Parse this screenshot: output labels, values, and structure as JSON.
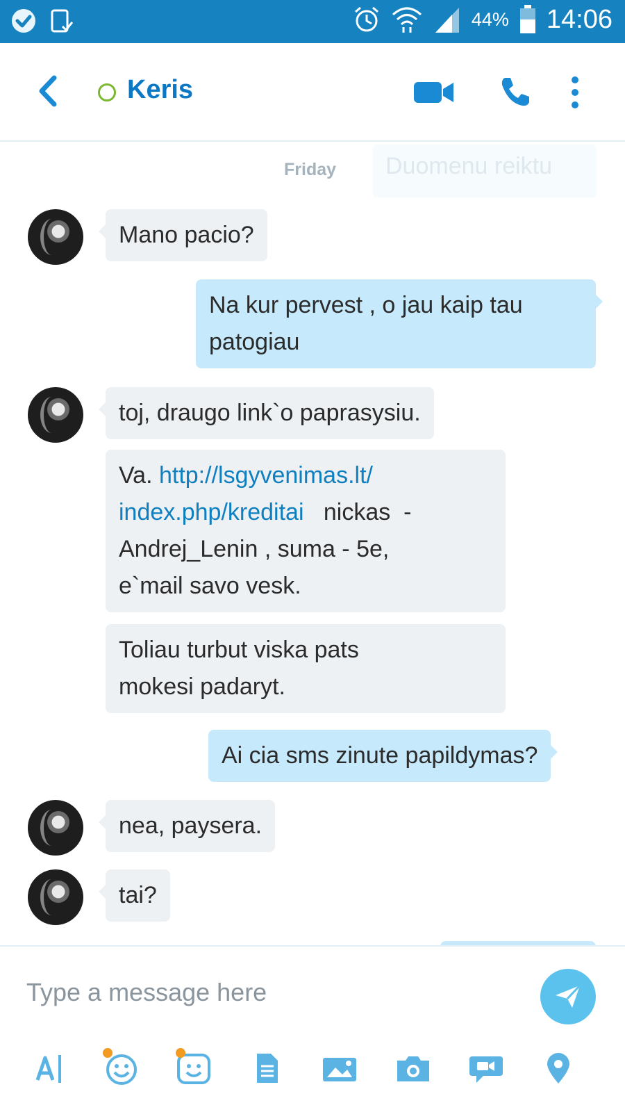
{
  "status_bar": {
    "battery": "44%",
    "time": "14:06",
    "icons": [
      "check-badge-icon",
      "device-icon",
      "alarm-icon",
      "wifi-icon",
      "signal-icon",
      "battery-icon"
    ],
    "colors": {
      "background": "#1683c0"
    }
  },
  "header": {
    "contact_name": "Keris",
    "presence": "offline-ring",
    "icons": [
      "back-arrow-icon",
      "video-call-icon",
      "phone-icon",
      "more-vertical-icon"
    ],
    "colors": {
      "accent": "#0b78c6",
      "presence": "#7cb82f"
    }
  },
  "conversation": {
    "day_label": "Friday",
    "faded_message": "Duomenu reiktu",
    "messages": [
      {
        "from": "contact",
        "text": "Mano pacio?"
      },
      {
        "from": "me",
        "line1": "Na kur pervest , o jau kaip tau",
        "line2": "patogiau"
      },
      {
        "from": "contact",
        "text": "toj, draugo link`o paprasysiu."
      },
      {
        "from": "contact",
        "prefix": "Va. ",
        "link1": "http://lsgyvenimas.lt/",
        "link2": "index.php/kreditai",
        "after_link": "   nickas  -",
        "line3": "Andrej_Lenin , suma - 5e,",
        "line4": "e`mail savo vesk."
      },
      {
        "from": "contact",
        "line1": "Toliau turbut viska pats",
        "line2": "mokesi padaryt."
      },
      {
        "from": "me",
        "text": "Ai cia sms zinute papildymas?"
      },
      {
        "from": "contact",
        "text": "nea, paysera."
      },
      {
        "from": "contact",
        "text": "tai?"
      }
    ],
    "colors": {
      "incoming_bubble": "#edf1f4",
      "outgoing_bubble": "#c6e9fb",
      "link": "#0f7fbf"
    }
  },
  "composer": {
    "placeholder": "Type a message here",
    "toolbar_icons": [
      "text-format-icon",
      "emoticon-icon",
      "moji-icon",
      "file-icon",
      "photo-gallery-icon",
      "camera-icon",
      "video-message-icon",
      "location-icon"
    ],
    "send_icon": "send-icon",
    "colors": {
      "send_button": "#5bc2ee",
      "tool_icon": "#5ab3e3",
      "notification_dot": "#f39a20"
    }
  }
}
